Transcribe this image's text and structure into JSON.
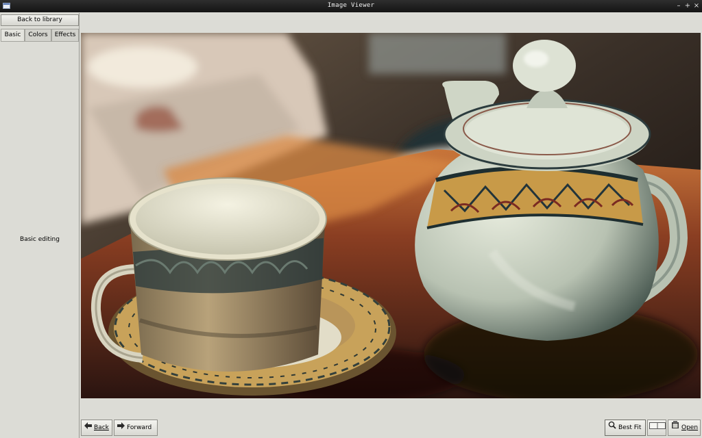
{
  "window": {
    "title": "Image Viewer",
    "minimize": "–",
    "maximize": "+",
    "close": "×"
  },
  "sidebar": {
    "back_label": "Back to library",
    "tabs": [
      {
        "label": "Basic"
      },
      {
        "label": "Colors"
      },
      {
        "label": "Effects"
      }
    ],
    "panel_caption": "Basic editing"
  },
  "bottom": {
    "back_label": "Back",
    "forward_label": "Forward",
    "best_fit_label": "Best Fit",
    "open_label": "Open"
  },
  "icons": [
    "arrow-left-icon",
    "arrow-right-icon",
    "magnifier-icon",
    "split-view-icon",
    "open-icon"
  ]
}
